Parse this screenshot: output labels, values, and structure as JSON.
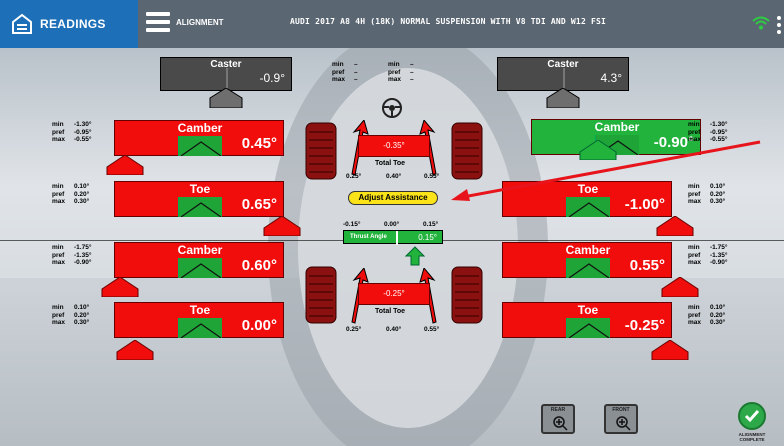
{
  "header": {
    "readings_label": "READINGS",
    "alignment_label": "ALIGNMENT",
    "vehicle": "AUDI 2017 A8 4H (18K) NORMAL SUSPENSION WITH V8 TDI AND W12 FSI"
  },
  "caster": {
    "left": {
      "title": "Caster",
      "value": "-0.9°"
    },
    "right": {
      "title": "Caster",
      "value": "4.3°"
    },
    "center_spec": {
      "min": "min",
      "pref": "pref",
      "max": "max",
      "dash": "–"
    }
  },
  "front": {
    "left_camber": {
      "title": "Camber",
      "value": "0.45°",
      "min": "-1.30°",
      "pref": "-0.95°",
      "max": "-0.55°"
    },
    "left_toe": {
      "title": "Toe",
      "value": "0.65°",
      "min": "0.10°",
      "pref": "0.20°",
      "max": "0.30°"
    },
    "right_camber": {
      "title": "Camber",
      "value": "-0.90°",
      "min": "-1.30°",
      "pref": "-0.95°",
      "max": "-0.55°"
    },
    "right_toe": {
      "title": "Toe",
      "value": "-1.00°",
      "min": "0.10°",
      "pref": "0.20°",
      "max": "0.30°"
    },
    "total_toe": {
      "label": "Total Toe",
      "value": "-0.35°",
      "min": "0.25°",
      "pref": "0.40°",
      "max": "0.55°"
    }
  },
  "rear": {
    "left_camber": {
      "title": "Camber",
      "value": "0.60°",
      "min": "-1.75°",
      "pref": "-1.35°",
      "max": "-0.90°"
    },
    "left_toe": {
      "title": "Toe",
      "value": "0.00°",
      "min": "0.10°",
      "pref": "0.20°",
      "max": "0.30°"
    },
    "right_camber": {
      "title": "Camber",
      "value": "0.55°",
      "min": "-1.75°",
      "pref": "-1.35°",
      "max": "-0.90°"
    },
    "right_toe": {
      "title": "Toe",
      "value": "-0.25°",
      "min": "0.10°",
      "pref": "0.20°",
      "max": "0.30°"
    },
    "total_toe": {
      "label": "Total Toe",
      "value": "-0.25°",
      "min": "0.25°",
      "pref": "0.40°",
      "max": "0.55°"
    }
  },
  "thrust": {
    "label": "Thrust Angle",
    "value": "0.15°",
    "min": "-0.15°",
    "pref": "0.00°",
    "max": "0.15°"
  },
  "adjust_assistance": "Adjust Assistance",
  "spec_labels": {
    "min": "min",
    "pref": "pref",
    "max": "max"
  },
  "buttons": {
    "rear": "REAR",
    "front": "FRONT",
    "complete_line1": "ALIGNMENT",
    "complete_line2": "COMPLETE"
  },
  "colors": {
    "red": "#f20d0d",
    "green": "#22b33c",
    "header": "#5a6672",
    "tab": "#1d6fb8",
    "adjust": "#fbe31a"
  }
}
